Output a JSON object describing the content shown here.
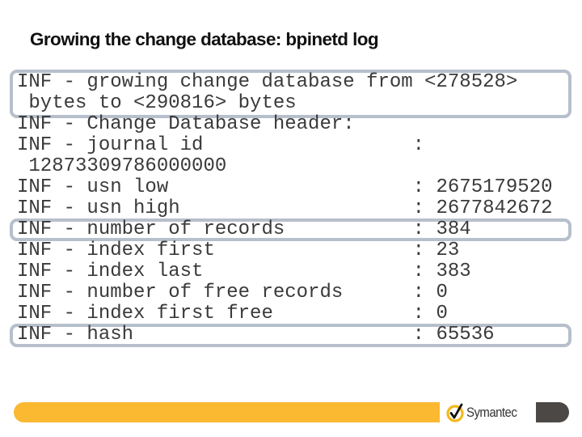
{
  "slide": {
    "title": "Growing the change database: bpinetd log"
  },
  "log": {
    "lines": [
      "INF - growing change database from <278528>",
      " bytes to <290816> bytes",
      "INF - Change Database header:",
      "INF - journal id                  :",
      " 12873309786000000",
      "INF - usn low                     : 2675179520",
      "INF - usn high                    : 2677842672",
      "INF - number of records           : 384",
      "INF - index first                 : 23",
      "INF - index last                  : 383",
      "INF - number of free records      : 0",
      "INF - index first free            : 0",
      "INF - hash                        : 65536"
    ],
    "highlighted": [
      "growing change database from <278528> bytes to <290816> bytes",
      "number of records : 384",
      "hash : 65536"
    ]
  },
  "footer": {
    "brand": "Symantec",
    "brand_suffix": ".",
    "logo_icon": "checkmark-circle-icon",
    "colors": {
      "bar": "#fbb831",
      "tab": "#4b4846",
      "highlight_border": "#b6bfcb"
    }
  }
}
